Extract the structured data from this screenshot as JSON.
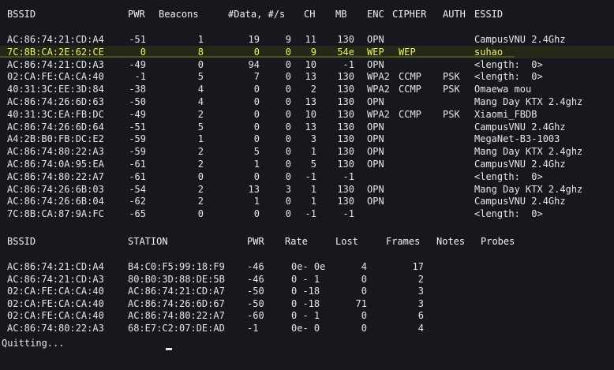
{
  "ap_header": [
    "BSSID",
    "PWR",
    "Beacons",
    "#Data, #/s",
    "CH",
    "MB",
    "ENC",
    "CIPHER",
    "AUTH",
    "ESSID"
  ],
  "ap_rows": [
    {
      "bssid": "AC:86:74:21:CD:A4",
      "pwr": "-51",
      "beacons": "1",
      "data": "19",
      "per_s": "9",
      "ch": "11",
      "mb": "130",
      "enc": "OPN",
      "cipher": "",
      "auth": "",
      "essid": "CampusVNU 2.4Ghz"
    },
    {
      "bssid": "7C:8B:CA:2E:62:CE",
      "pwr": "0",
      "beacons": "8",
      "data": "0",
      "per_s": "0",
      "ch": "9",
      "mb": "54e",
      "enc": "WEP",
      "cipher": "WEP",
      "auth": "",
      "essid": "suhao",
      "highlight": true
    },
    {
      "bssid": "AC:86:74:21:CD:A3",
      "pwr": "-49",
      "beacons": "0",
      "data": "94",
      "per_s": "0",
      "ch": "10",
      "mb": "-1",
      "enc": "OPN",
      "cipher": "",
      "auth": "",
      "essid": "<length:  0>"
    },
    {
      "bssid": "02:CA:FE:CA:CA:40",
      "pwr": "-1",
      "beacons": "5",
      "data": "7",
      "per_s": "0",
      "ch": "13",
      "mb": "130",
      "enc": "WPA2",
      "cipher": "CCMP",
      "auth": "PSK",
      "essid": "<length:  0>"
    },
    {
      "bssid": "40:31:3C:EE:3D:84",
      "pwr": "-38",
      "beacons": "4",
      "data": "0",
      "per_s": "0",
      "ch": "2",
      "mb": "130",
      "enc": "WPA2",
      "cipher": "CCMP",
      "auth": "PSK",
      "essid": "Omaewa mou"
    },
    {
      "bssid": "AC:86:74:26:6D:63",
      "pwr": "-50",
      "beacons": "4",
      "data": "0",
      "per_s": "0",
      "ch": "13",
      "mb": "130",
      "enc": "OPN",
      "cipher": "",
      "auth": "",
      "essid": "Mang Day KTX 2.4ghz"
    },
    {
      "bssid": "40:31:3C:EA:FB:DC",
      "pwr": "-49",
      "beacons": "2",
      "data": "0",
      "per_s": "0",
      "ch": "10",
      "mb": "130",
      "enc": "WPA2",
      "cipher": "CCMP",
      "auth": "PSK",
      "essid": "Xiaomi_FBDB"
    },
    {
      "bssid": "AC:86:74:26:6D:64",
      "pwr": "-51",
      "beacons": "5",
      "data": "0",
      "per_s": "0",
      "ch": "13",
      "mb": "130",
      "enc": "OPN",
      "cipher": "",
      "auth": "",
      "essid": "CampusVNU 2.4Ghz"
    },
    {
      "bssid": "A4:2B:B0:FB:DC:E2",
      "pwr": "-59",
      "beacons": "1",
      "data": "0",
      "per_s": "0",
      "ch": "3",
      "mb": "130",
      "enc": "OPN",
      "cipher": "",
      "auth": "",
      "essid": "MegaNet-B3-1003"
    },
    {
      "bssid": "AC:86:74:80:22:A3",
      "pwr": "-59",
      "beacons": "2",
      "data": "5",
      "per_s": "0",
      "ch": "1",
      "mb": "130",
      "enc": "OPN",
      "cipher": "",
      "auth": "",
      "essid": "Mang Day KTX 2.4ghz"
    },
    {
      "bssid": "AC:86:74:0A:95:EA",
      "pwr": "-61",
      "beacons": "2",
      "data": "1",
      "per_s": "0",
      "ch": "5",
      "mb": "130",
      "enc": "OPN",
      "cipher": "",
      "auth": "",
      "essid": "CampusVNU 2.4Ghz"
    },
    {
      "bssid": "AC:86:74:80:22:A7",
      "pwr": "-61",
      "beacons": "0",
      "data": "0",
      "per_s": "0",
      "ch": "-1",
      "mb": "-1",
      "enc": "",
      "cipher": "",
      "auth": "",
      "essid": "<length:  0>"
    },
    {
      "bssid": "AC:86:74:26:6B:03",
      "pwr": "-54",
      "beacons": "2",
      "data": "13",
      "per_s": "3",
      "ch": "1",
      "mb": "130",
      "enc": "OPN",
      "cipher": "",
      "auth": "",
      "essid": "Mang Day KTX 2.4ghz"
    },
    {
      "bssid": "AC:86:74:26:6B:04",
      "pwr": "-62",
      "beacons": "2",
      "data": "1",
      "per_s": "0",
      "ch": "1",
      "mb": "130",
      "enc": "OPN",
      "cipher": "",
      "auth": "",
      "essid": "CampusVNU 2.4Ghz"
    },
    {
      "bssid": "7C:8B:CA:87:9A:FC",
      "pwr": "-65",
      "beacons": "0",
      "data": "0",
      "per_s": "0",
      "ch": "-1",
      "mb": "-1",
      "enc": "",
      "cipher": "",
      "auth": "",
      "essid": "<length:  0>"
    }
  ],
  "station_header": [
    "BSSID",
    "STATION",
    "PWR",
    "Rate",
    "Lost",
    "Frames",
    "Notes",
    "Probes"
  ],
  "station_rows": [
    {
      "bssid": "AC:86:74:21:CD:A4",
      "station": "B4:C0:F5:99:18:F9",
      "pwr": "-46",
      "rate": "0e- 0e",
      "lost": "4",
      "frames": "17"
    },
    {
      "bssid": "AC:86:74:21:CD:A3",
      "station": "80:B0:3D:88:DE:5B",
      "pwr": "-46",
      "rate": "0 - 1",
      "lost": "0",
      "frames": "2"
    },
    {
      "bssid": "02:CA:FE:CA:CA:40",
      "station": "AC:86:74:21:CD:A7",
      "pwr": "-50",
      "rate": "0 -18",
      "lost": "0",
      "frames": "3"
    },
    {
      "bssid": "02:CA:FE:CA:CA:40",
      "station": "AC:86:74:26:6D:67",
      "pwr": "-50",
      "rate": "0 -18",
      "lost": "71",
      "frames": "3"
    },
    {
      "bssid": "02:CA:FE:CA:CA:40",
      "station": "AC:86:74:80:22:A7",
      "pwr": "-60",
      "rate": "0 - 1",
      "lost": "0",
      "frames": "6"
    },
    {
      "bssid": "AC:86:74:80:22:A3",
      "station": "68:E7:C2:07:DE:AD",
      "pwr": "-1",
      "rate": "0e- 0",
      "lost": "0",
      "frames": "4"
    }
  ],
  "status_line": "Quitting...",
  "colors": {
    "background": "#16181d",
    "text": "#e6e6e6",
    "highlight_text": "#f0f06a",
    "highlight_bg": "#242818"
  }
}
